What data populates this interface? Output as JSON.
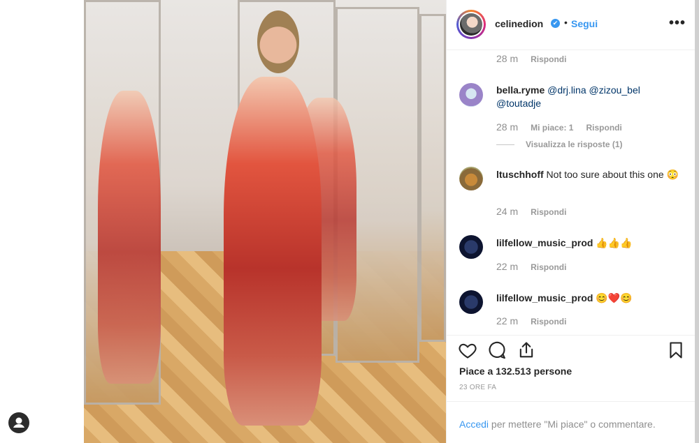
{
  "post": {
    "username": "celinedion",
    "verified_mark": "✔",
    "separator": "•",
    "follow_label": "Segui",
    "more_label": "•••"
  },
  "comments": [
    {
      "time": "28 m",
      "reply": "Rispondi"
    },
    {
      "user": "bella.ryme",
      "text_mentions": [
        "@drj.lina",
        "@zizou_bel",
        "@toutadje"
      ],
      "time": "28 m",
      "likes": "Mi piace: 1",
      "reply": "Rispondi",
      "view_replies": "Visualizza le risposte (1)"
    },
    {
      "user": "ltuschhoff",
      "text": "Not too sure about this one 😳",
      "time": "24 m",
      "reply": "Rispondi"
    },
    {
      "user": "lilfellow_music_prod",
      "text": "👍👍👍",
      "time": "22 m",
      "reply": "Rispondi"
    },
    {
      "user": "lilfellow_music_prod",
      "text": "😊❤️😊",
      "time": "22 m",
      "reply": "Rispondi"
    }
  ],
  "footer": {
    "likes": "Piace a 132.513 persone",
    "time_ago": "23 ORE FA",
    "login_link": "Accedi",
    "login_text": " per mettere \"Mi piace\" o commentare."
  },
  "icons": [
    "heart-icon",
    "comment-icon",
    "share-icon",
    "bookmark-icon",
    "profile-icon"
  ],
  "colors": {
    "accent": "#3897f0",
    "text": "#262626",
    "muted": "#8e8e8e",
    "border": "#efefef"
  }
}
